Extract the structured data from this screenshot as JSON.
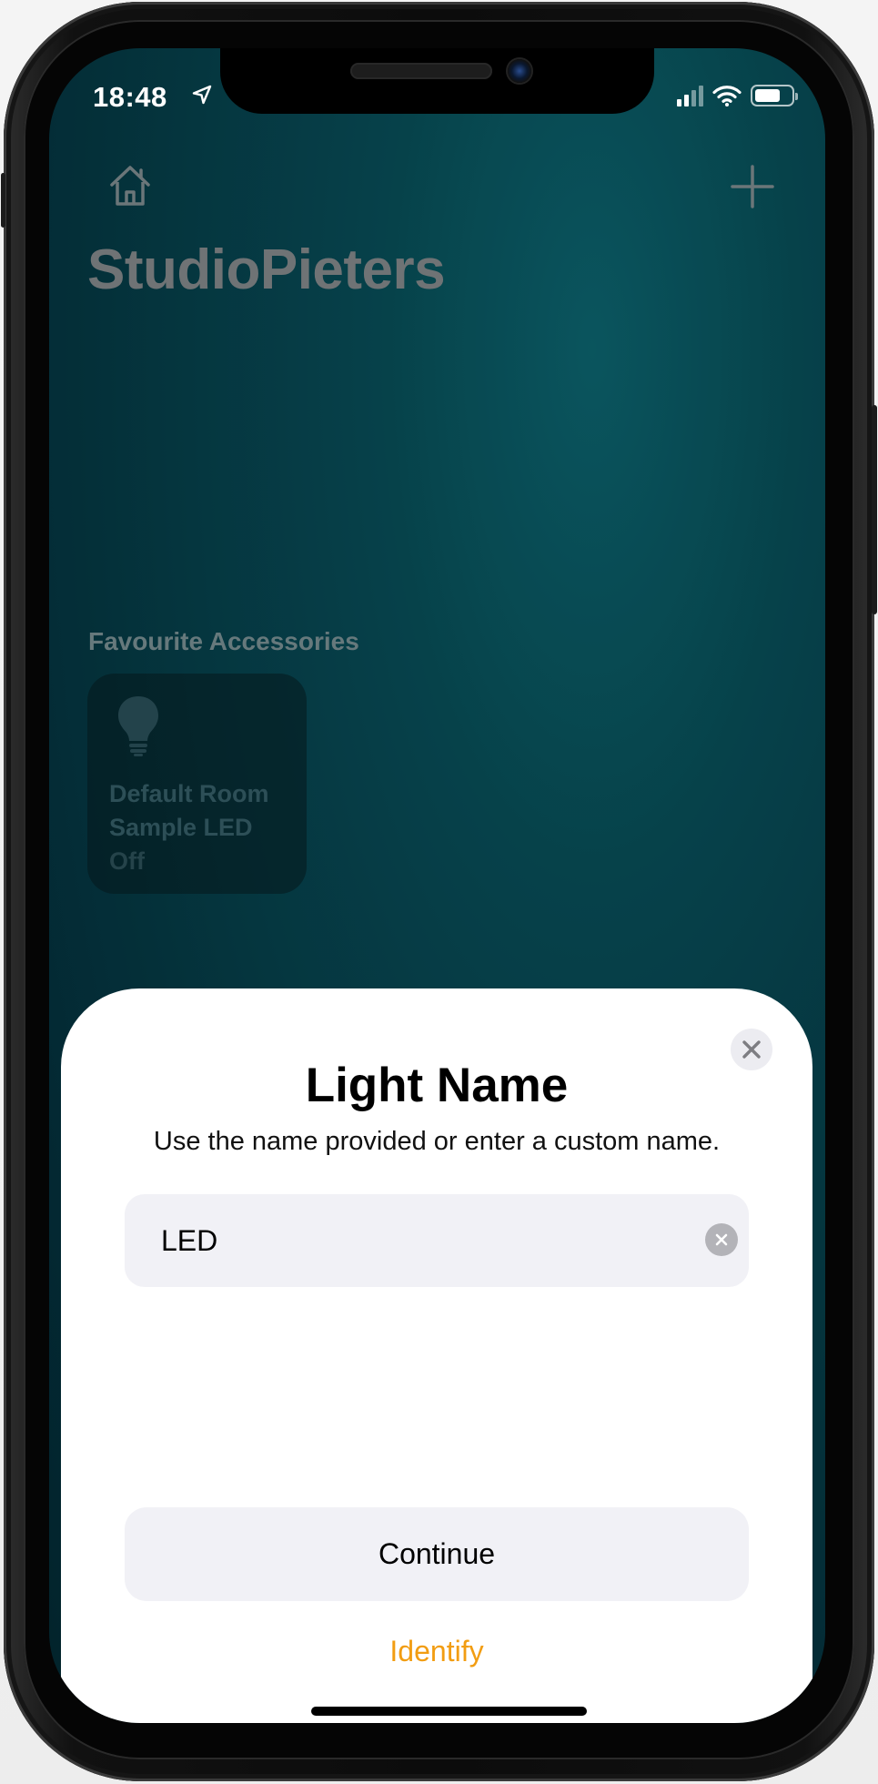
{
  "status_bar": {
    "time": "18:48",
    "icons": [
      "location-arrow-icon",
      "cellular-signal-icon",
      "wifi-icon",
      "battery-icon"
    ],
    "battery_level": 0.7
  },
  "home": {
    "home_icon": "house-icon",
    "add_icon": "plus-icon",
    "title": "StudioPieters",
    "favourites_title": "Favourite Accessories",
    "tile": {
      "icon": "lightbulb-icon",
      "room": "Default Room",
      "name": "Sample LED",
      "state": "Off"
    }
  },
  "sheet": {
    "title": "Light Name",
    "subtitle": "Use the name provided or enter a custom name.",
    "close_icon": "close-icon",
    "name_value": "LED",
    "clear_icon": "clear-icon",
    "continue_label": "Continue",
    "identify_label": "Identify",
    "accent_color": "#f29d12"
  },
  "colors": {
    "background": "#063842",
    "sheet": "#ffffff",
    "field": "#f1f1f6"
  }
}
